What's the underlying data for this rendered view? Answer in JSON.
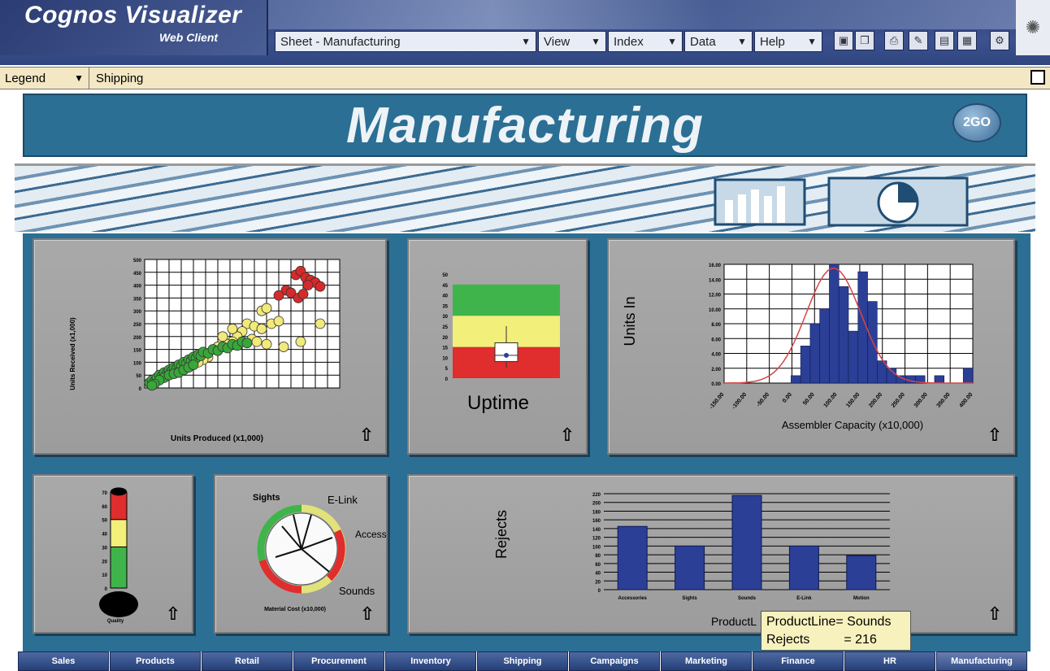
{
  "app": {
    "title_main": "Cognos Visualizer",
    "title_sub": "Web Client"
  },
  "menu": {
    "sheet": "Sheet - Manufacturing",
    "view": "View",
    "index": "Index",
    "data": "Data",
    "help": "Help"
  },
  "toolbar_icons": [
    "save-icon",
    "copy-icon",
    "print-icon",
    "edit-icon",
    "layout-icon",
    "grid-icon",
    "settings-icon"
  ],
  "subbar": {
    "legend": "Legend",
    "shipping": "Shipping"
  },
  "page": {
    "title": "Manufacturing",
    "badge": "2GO"
  },
  "panels": {
    "scatter": {
      "xlabel": "Units Produced (x1,000)",
      "ylabel": "Units Received (x1,000)"
    },
    "uptime": {
      "label": "Uptime"
    },
    "histogram": {
      "xlabel": "Assembler Capacity (x10,000)",
      "ylabel": "Units In"
    },
    "thermo": {
      "label": "Quality"
    },
    "radial": {
      "label_tl": "Sights",
      "label_top": "E-Link",
      "label_right": "Accessorie...",
      "label_bottom": "Sounds",
      "caption": "Material Cost (x10,000)"
    },
    "rejects": {
      "ylabel": "Rejects",
      "xlabel": "ProductL"
    }
  },
  "chart_data": [
    {
      "type": "scatter",
      "xlabel": "Units Produced (x1,000)",
      "ylabel": "Units Received (x1,000)",
      "ylim": [
        0,
        500
      ],
      "yticks": [
        0,
        50,
        100,
        150,
        200,
        250,
        300,
        350,
        400,
        450,
        500
      ],
      "series": [
        {
          "color": "#d62a2a",
          "points": [
            [
              62,
              440
            ],
            [
              64,
              455
            ],
            [
              66,
              430
            ],
            [
              68,
              420
            ],
            [
              70,
              410
            ],
            [
              67,
              400
            ],
            [
              72,
              395
            ],
            [
              58,
              380
            ],
            [
              55,
              360
            ],
            [
              60,
              370
            ],
            [
              63,
              350
            ],
            [
              65,
              365
            ]
          ]
        },
        {
          "color": "#f1e97a",
          "points": [
            [
              42,
              250
            ],
            [
              45,
              240
            ],
            [
              48,
              230
            ],
            [
              40,
              220
            ],
            [
              38,
              200
            ],
            [
              44,
              190
            ],
            [
              46,
              180
            ],
            [
              50,
              170
            ],
            [
              36,
              180
            ],
            [
              34,
              170
            ],
            [
              30,
              160
            ],
            [
              28,
              150
            ],
            [
              32,
              200
            ],
            [
              36,
              230
            ],
            [
              52,
              250
            ],
            [
              55,
              260
            ],
            [
              57,
              160
            ],
            [
              64,
              180
            ],
            [
              72,
              250
            ],
            [
              48,
              300
            ],
            [
              50,
              310
            ],
            [
              26,
              120
            ],
            [
              24,
              110
            ],
            [
              22,
              100
            ]
          ]
        },
        {
          "color": "#39a63a",
          "points": [
            [
              2,
              20
            ],
            [
              3,
              30
            ],
            [
              4,
              25
            ],
            [
              5,
              40
            ],
            [
              6,
              50
            ],
            [
              7,
              45
            ],
            [
              8,
              60
            ],
            [
              9,
              55
            ],
            [
              10,
              70
            ],
            [
              11,
              65
            ],
            [
              12,
              80
            ],
            [
              13,
              75
            ],
            [
              14,
              90
            ],
            [
              15,
              85
            ],
            [
              16,
              100
            ],
            [
              17,
              95
            ],
            [
              18,
              110
            ],
            [
              19,
              105
            ],
            [
              20,
              120
            ],
            [
              21,
              115
            ],
            [
              22,
              130
            ],
            [
              23,
              125
            ],
            [
              24,
              140
            ],
            [
              26,
              135
            ],
            [
              28,
              150
            ],
            [
              30,
              145
            ],
            [
              32,
              160
            ],
            [
              34,
              155
            ],
            [
              36,
              170
            ],
            [
              38,
              165
            ],
            [
              40,
              180
            ],
            [
              42,
              175
            ],
            [
              8,
              40
            ],
            [
              10,
              50
            ],
            [
              12,
              55
            ],
            [
              14,
              60
            ],
            [
              16,
              70
            ],
            [
              18,
              80
            ],
            [
              20,
              90
            ],
            [
              6,
              30
            ],
            [
              4,
              15
            ],
            [
              3,
              10
            ]
          ]
        }
      ]
    },
    {
      "type": "box",
      "title": "Uptime",
      "ylim": [
        0,
        50
      ],
      "yticks": [
        0,
        5,
        10,
        15,
        20,
        25,
        30,
        35,
        40,
        45,
        50
      ],
      "bands": [
        {
          "from": 0,
          "to": 15,
          "color": "#e02d2d"
        },
        {
          "from": 15,
          "to": 30,
          "color": "#f2ef7a"
        },
        {
          "from": 30,
          "to": 45,
          "color": "#3fb44a"
        }
      ],
      "box": {
        "min": 5,
        "q1": 8,
        "median": 11,
        "q3": 17,
        "max": 25,
        "mean": 11
      }
    },
    {
      "type": "bar",
      "subtype": "histogram",
      "xlabel": "Assembler Capacity (x10,000)",
      "ylabel": "Units In",
      "ylim": [
        0,
        16
      ],
      "yticks": [
        "0.00",
        "2.00",
        "4.00",
        "6.00",
        "8.00",
        "10.00",
        "12.00",
        "14.00",
        "16.00"
      ],
      "categories": [
        "-150.00",
        "-100.00",
        "-50.00",
        "0.00",
        "50.00",
        "100.00",
        "150.00",
        "200.00",
        "250.00",
        "300.00",
        "350.00",
        "400.00"
      ],
      "values": [
        0,
        0,
        0,
        0,
        0,
        0,
        0,
        1,
        5,
        8,
        10,
        16,
        13,
        7,
        15,
        11,
        3,
        2,
        1,
        1,
        1,
        0,
        1,
        0,
        0,
        2
      ],
      "curve_color": "#d64545",
      "bar_color": "#2c3f96"
    },
    {
      "type": "gauge",
      "subtype": "thermometer",
      "ylim": [
        0,
        70
      ],
      "yticks": [
        0,
        10,
        20,
        30,
        40,
        50,
        60,
        70
      ],
      "value": 68
    },
    {
      "type": "gauge",
      "subtype": "radial",
      "caption": "Material Cost (x10,000)"
    },
    {
      "type": "bar",
      "ylabel": "Rejects",
      "xlabel": "ProductLine",
      "ylim": [
        0,
        220
      ],
      "yticks": [
        0,
        20,
        40,
        60,
        80,
        100,
        120,
        140,
        160,
        180,
        200,
        220
      ],
      "categories": [
        "Accessories",
        "Sights",
        "Sounds",
        "E-Link",
        "Motion"
      ],
      "values": [
        145,
        100,
        216,
        100,
        78
      ]
    }
  ],
  "tooltip": {
    "line1": "ProductLine= Sounds",
    "line2_label": "Rejects",
    "line2_value": "= 216"
  },
  "tabs": [
    "Sales",
    "Products",
    "Retail",
    "Procurement",
    "Inventory",
    "Shipping",
    "Campaigns",
    "Marketing",
    "Finance",
    "HR",
    "Manufacturing"
  ],
  "active_tab": "Manufacturing"
}
